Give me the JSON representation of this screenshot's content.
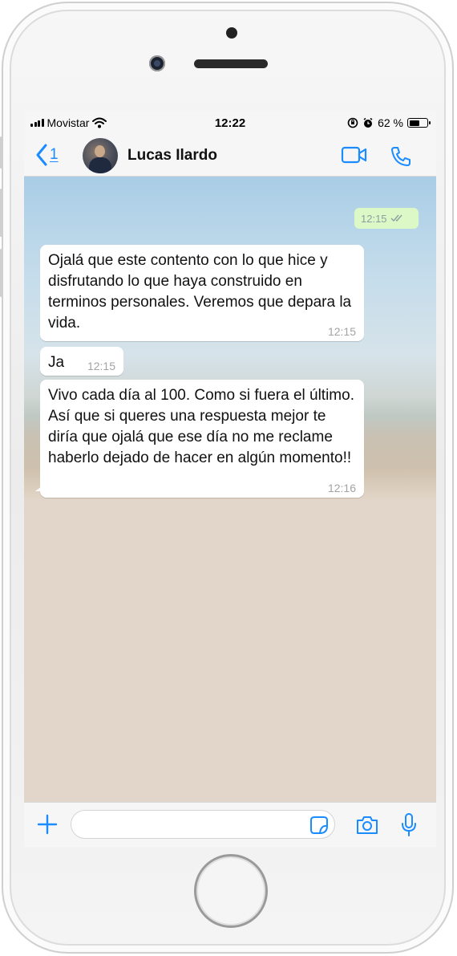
{
  "status_bar": {
    "carrier": "Movistar",
    "time": "12:22",
    "battery": "62 %",
    "battery_level": 0.62
  },
  "header": {
    "back_count": "1",
    "contact_name": "Lucas Ilardo"
  },
  "messages": [
    {
      "direction": "out",
      "text": "",
      "time": "12:15"
    },
    {
      "direction": "in",
      "text": "Ojalá que este contento con lo que hice y disfrutando lo que haya construido en terminos personales. Veremos que depara la vida.",
      "time": "12:15"
    },
    {
      "direction": "in",
      "text": "Ja",
      "time": "12:15"
    },
    {
      "direction": "in",
      "text": "Vivo cada día al 100. Como si fuera el último. Así que si queres una respuesta mejor te diría que ojalá que ese día no me reclame haberlo dejado de hacer en algún momento!!",
      "time": "12:16"
    }
  ],
  "input": {
    "value": "",
    "placeholder": ""
  },
  "icons": [
    "signal-icon",
    "wifi-icon",
    "lock-rotation-icon",
    "alarm-icon",
    "battery-icon",
    "back-chevron-icon",
    "video-call-icon",
    "phone-call-icon",
    "read-receipt-icon",
    "plus-icon",
    "sticker-icon",
    "camera-icon",
    "microphone-icon"
  ],
  "colors": {
    "accent": "#1a8cff",
    "outgoing_bubble": "#dcf8c6",
    "incoming_bubble": "#ffffff",
    "chat_background": "#e1d6c9",
    "bar_background": "#f6f6f7"
  }
}
